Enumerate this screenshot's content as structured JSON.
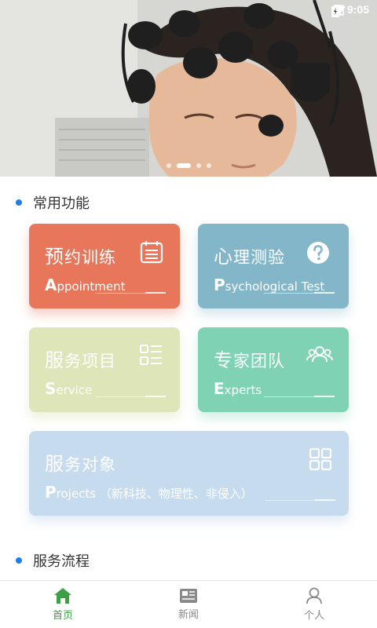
{
  "status_bar": {
    "time": "9:05",
    "icons": [
      "wifi-icon",
      "no-signal-icon",
      "battery-charging-icon"
    ]
  },
  "banner": {
    "image": "photo of woman wearing EEG cap",
    "dot_count": 4,
    "active_dot": 1
  },
  "sections": {
    "common": "常用功能",
    "process": "服务流程"
  },
  "cards": {
    "appointment": {
      "cn_first": "预",
      "cn_rest": "约训练",
      "en_cap": "A",
      "en_rest": "ppointment",
      "icon": "calendar-icon",
      "color": "#e8765a"
    },
    "psychological": {
      "cn_first": "心",
      "cn_rest": "理测验",
      "en_cap": "P",
      "en_rest": "sychological Test",
      "icon": "question-circle-icon",
      "color": "#84b6c9"
    },
    "service": {
      "cn_first": "服",
      "cn_rest": "务项目",
      "en_cap": "S",
      "en_rest": "ervice",
      "icon": "list-icon",
      "color": "#dde5b9"
    },
    "experts": {
      "cn_first": "专",
      "cn_rest": "家团队",
      "en_cap": "E",
      "en_rest": "xperts",
      "icon": "group-icon",
      "color": "#7fd3b4"
    },
    "projects": {
      "cn_first": "服",
      "cn_rest": "务对象",
      "en_cap": "P",
      "en_rest": "rojects （新科技、物理性、非侵入）",
      "icon": "grid-icon",
      "color": "#c6dbed"
    }
  },
  "bottom_nav": {
    "items": [
      {
        "label": "首页",
        "icon": "home-icon",
        "active": true
      },
      {
        "label": "新闻",
        "icon": "news-icon",
        "active": false
      },
      {
        "label": "个人",
        "icon": "person-icon",
        "active": false
      }
    ]
  },
  "colors": {
    "accent_blue": "#1e7ee8",
    "nav_active": "#3aa043"
  }
}
